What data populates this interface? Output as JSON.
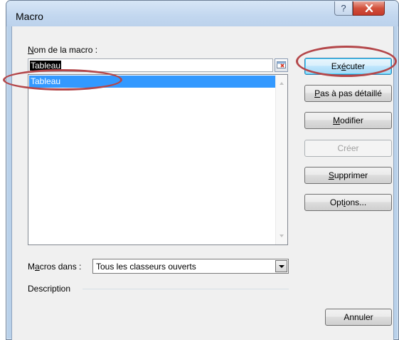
{
  "window": {
    "title": "Macro",
    "help_glyph": "?",
    "close_glyph": "x"
  },
  "name_section": {
    "label_prefix": "",
    "label_mnemonic": "N",
    "label_rest": "om de la macro :",
    "value": "Tableau"
  },
  "macro_list": {
    "items": [
      "Tableau"
    ],
    "selected": "Tableau"
  },
  "buttons": {
    "run": {
      "before": "Ex",
      "mnemonic": "é",
      "after": "cuter"
    },
    "step": {
      "before": "",
      "mnemonic": "P",
      "after": "as à pas détaillé"
    },
    "edit": {
      "before": "",
      "mnemonic": "M",
      "after": "odifier"
    },
    "create": {
      "label": "Créer"
    },
    "delete": {
      "before": "",
      "mnemonic": "S",
      "after": "upprimer"
    },
    "options": {
      "before": "Opt",
      "mnemonic": "i",
      "after": "ons..."
    },
    "cancel": {
      "label": "Annuler"
    }
  },
  "macros_in": {
    "label_before": "M",
    "label_mnemonic": "a",
    "label_after": "cros dans :",
    "value": "Tous les classeurs ouverts"
  },
  "description": {
    "label": "Description",
    "text": ""
  },
  "colors": {
    "selection": "#3399ff",
    "annotation": "#b4474a"
  }
}
